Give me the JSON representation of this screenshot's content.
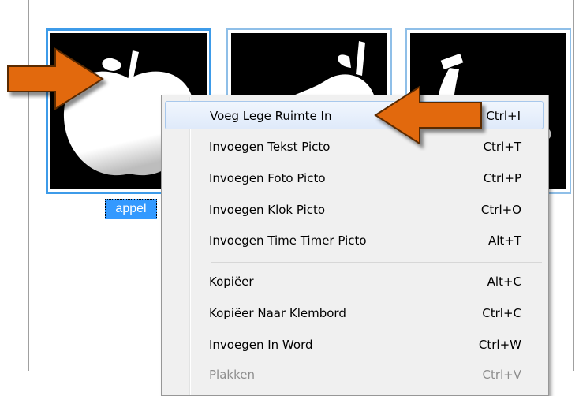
{
  "tiles": [
    {
      "name": "appel",
      "selected": true
    },
    {
      "name": "peer",
      "selected": false
    },
    {
      "name": "banaan",
      "selected": false
    }
  ],
  "selected_label": "appel",
  "menu": {
    "items": [
      {
        "label": "Voeg Lege Ruimte In",
        "shortcut": "Ctrl+I",
        "state": "highlighted"
      },
      {
        "label": "Invoegen Tekst Picto",
        "shortcut": "Ctrl+T",
        "state": "normal"
      },
      {
        "label": "Invoegen Foto Picto",
        "shortcut": "Ctrl+P",
        "state": "normal"
      },
      {
        "label": "Invoegen Klok Picto",
        "shortcut": "Ctrl+O",
        "state": "normal"
      },
      {
        "label": "Invoegen Time Timer Picto",
        "shortcut": "Alt+T",
        "state": "normal"
      },
      {
        "label": "Kopiëer",
        "shortcut": "Alt+C",
        "state": "normal"
      },
      {
        "label": "Kopiëer Naar Klembord",
        "shortcut": "Ctrl+C",
        "state": "normal"
      },
      {
        "label": "Invoegen In Word",
        "shortcut": "Ctrl+W",
        "state": "normal"
      },
      {
        "label": "Plakken",
        "shortcut": "Ctrl+V",
        "state": "disabled"
      }
    ]
  },
  "colors": {
    "selection": "#3399ff",
    "tile_border": "#3d9be9",
    "arrow": "#e2690f"
  }
}
